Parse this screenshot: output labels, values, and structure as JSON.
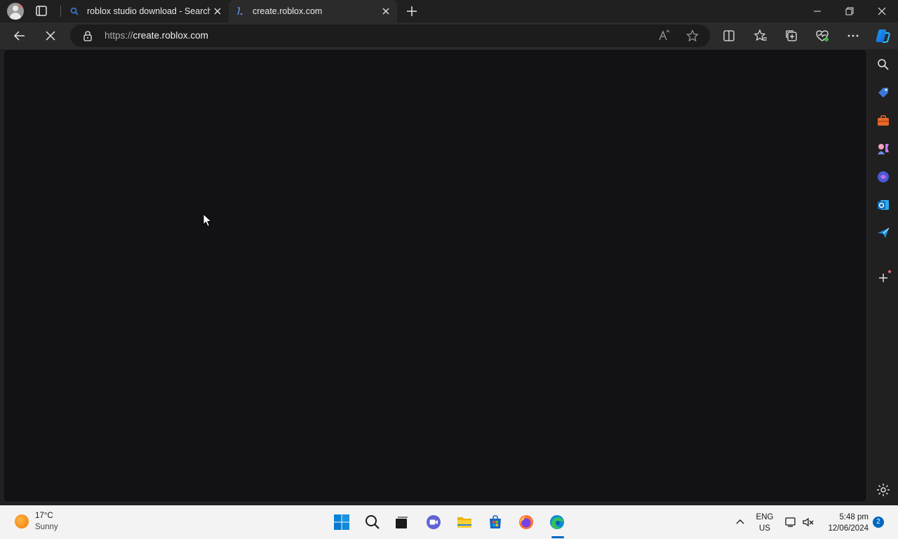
{
  "browser": {
    "tabs": [
      {
        "label": "roblox studio download - Search",
        "icon": "search-icon",
        "active": false
      },
      {
        "label": "create.roblox.com",
        "icon": "roblox-favicon",
        "active": true
      }
    ],
    "address": {
      "scheme": "https://",
      "host": "create.roblox.com"
    },
    "loading": true
  },
  "page": {
    "background_color": "#111116"
  },
  "taskbar": {
    "weather": {
      "temp": "17°C",
      "desc": "Sunny"
    },
    "language": {
      "line1": "ENG",
      "line2": "US"
    },
    "clock": {
      "time": "5:48 pm",
      "date": "12/06/2024"
    },
    "notification_count": "2"
  }
}
